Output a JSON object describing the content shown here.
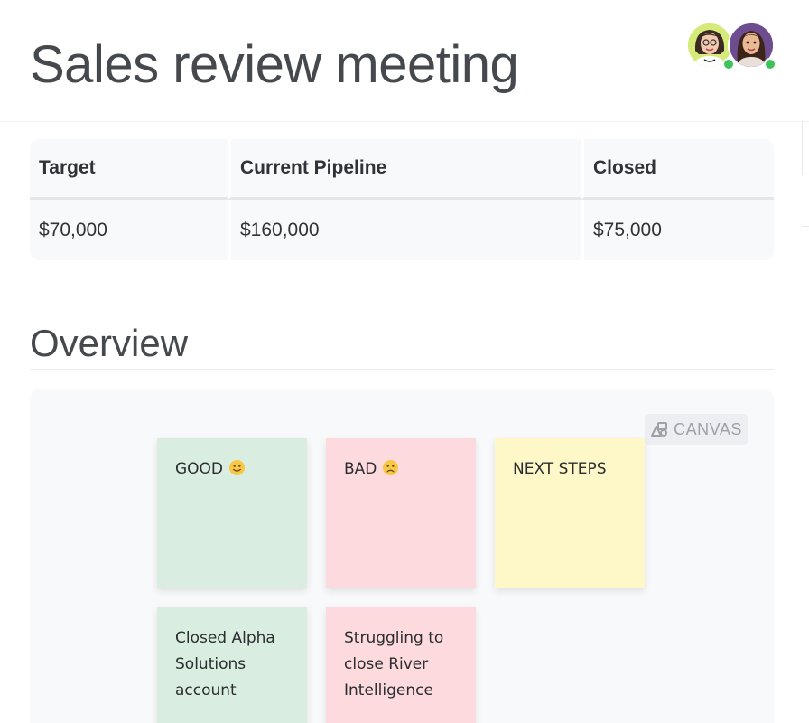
{
  "page": {
    "title": "Sales review meeting"
  },
  "collaborators": [
    {
      "name": "avatar-1",
      "status": "online"
    },
    {
      "name": "avatar-2",
      "status": "online"
    }
  ],
  "stats_table": {
    "headers": [
      "Target",
      "Current Pipeline",
      "Closed"
    ],
    "rows": [
      [
        "$70,000",
        "$160,000",
        "$75,000"
      ]
    ]
  },
  "overview": {
    "title": "Overview",
    "canvas_badge": "CANVAS",
    "canvas_badge_icon": "canvas-icon",
    "stickies": [
      {
        "text": "GOOD",
        "icon": "smile-emoji-icon",
        "color": "#d9eee1"
      },
      {
        "text": "BAD",
        "icon": "frown-emoji-icon",
        "color": "#fcdadd"
      },
      {
        "text": "NEXT STEPS",
        "color": "#fef7c8"
      },
      {
        "text": "Closed Alpha Solutions account",
        "color": "#d9eee1"
      },
      {
        "text": "Struggling to close River Intelligence",
        "color": "#fcdadd"
      }
    ]
  },
  "colors": {
    "presence": "#3ec35b",
    "table_bg": "#f8f9fb",
    "canvas_bg": "#f8f9fb"
  }
}
